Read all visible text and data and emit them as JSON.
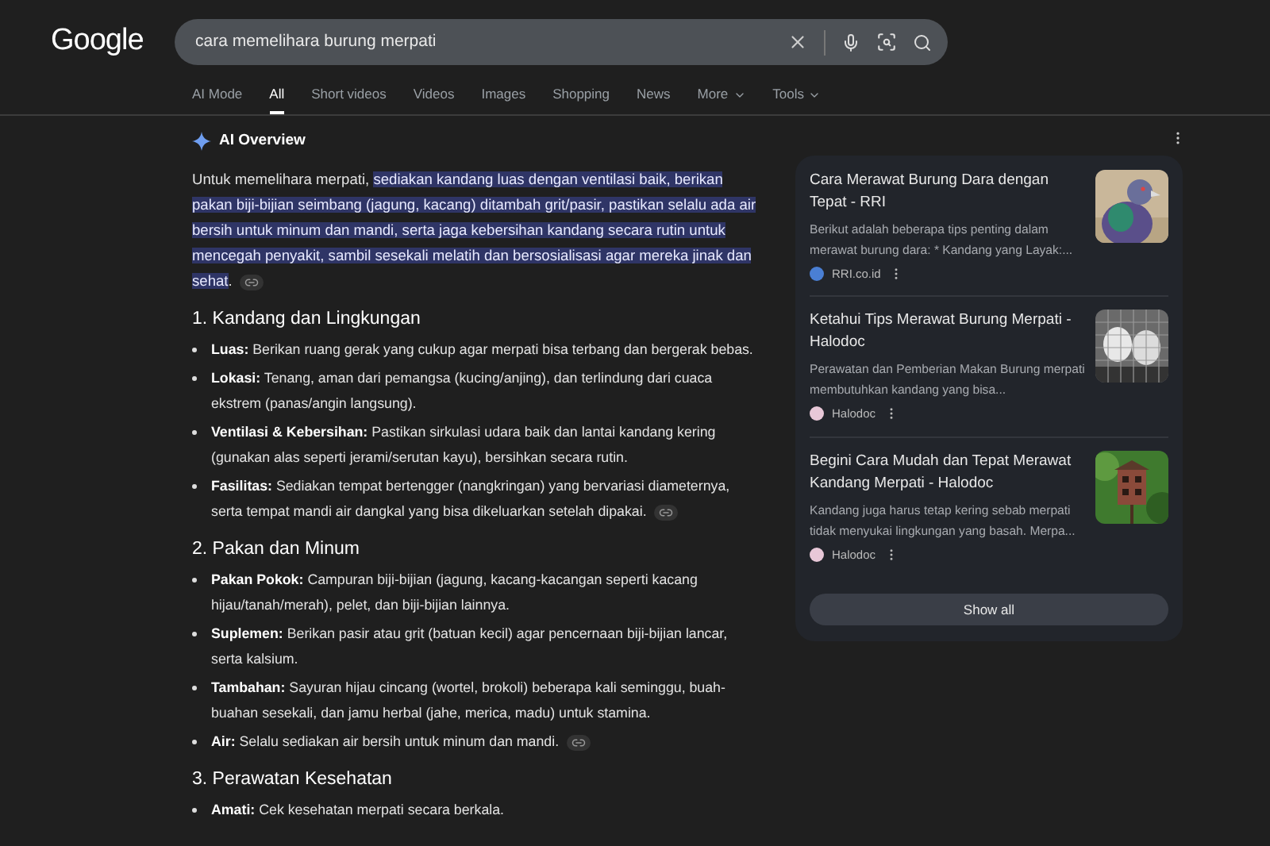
{
  "logo": "Google",
  "search": {
    "value": "cara memelihara burung merpati"
  },
  "tabs": [
    {
      "label": "AI Mode",
      "selected": false,
      "dropdown": false
    },
    {
      "label": "All",
      "selected": true,
      "dropdown": false
    },
    {
      "label": "Short videos",
      "selected": false,
      "dropdown": false
    },
    {
      "label": "Videos",
      "selected": false,
      "dropdown": false
    },
    {
      "label": "Images",
      "selected": false,
      "dropdown": false
    },
    {
      "label": "Shopping",
      "selected": false,
      "dropdown": false
    },
    {
      "label": "News",
      "selected": false,
      "dropdown": false
    },
    {
      "label": "More",
      "selected": false,
      "dropdown": true
    },
    {
      "label": "Tools",
      "selected": false,
      "dropdown": true
    }
  ],
  "ai_overview": {
    "title": "AI Overview",
    "intro": {
      "plain": "Untuk memelihara merpati,",
      "highlight": "sediakan kandang luas dengan ventilasi baik, berikan pakan biji-bijian seimbang (jagung, kacang) ditambah grit/pasir, pastikan selalu ada air bersih untuk minum dan mandi, serta jaga kebersihan kandang secara rutin untuk mencegah penyakit, sambil sesekali melatih dan bersosialisasi agar mereka jinak dan sehat",
      "end": "."
    },
    "sections": [
      {
        "heading": "1. Kandang dan Lingkungan",
        "items": [
          {
            "label": "Luas:",
            "text": "Berikan ruang gerak yang cukup agar merpati bisa terbang dan bergerak bebas.",
            "link": false
          },
          {
            "label": "Lokasi:",
            "text": "Tenang, aman dari pemangsa (kucing/anjing), dan terlindung dari cuaca ekstrem (panas/angin langsung).",
            "link": false
          },
          {
            "label": "Ventilasi & Kebersihan:",
            "text": "Pastikan sirkulasi udara baik dan lantai kandang kering (gunakan alas seperti jerami/serutan kayu), bersihkan secara rutin.",
            "link": false
          },
          {
            "label": "Fasilitas:",
            "text": "Sediakan tempat bertengger (nangkringan) yang bervariasi diameternya, serta tempat mandi air dangkal yang bisa dikeluarkan setelah dipakai.",
            "link": true
          }
        ]
      },
      {
        "heading": "2. Pakan dan Minum",
        "items": [
          {
            "label": "Pakan Pokok:",
            "text": "Campuran biji-bijian (jagung, kacang-kacangan seperti kacang hijau/tanah/merah), pelet, dan biji-bijian lainnya.",
            "link": false
          },
          {
            "label": "Suplemen:",
            "text": "Berikan pasir atau grit (batuan kecil) agar pencernaan biji-bijian lancar, serta kalsium.",
            "link": false
          },
          {
            "label": "Tambahan:",
            "text": "Sayuran hijau cincang (wortel, brokoli) beberapa kali seminggu, buah-buahan sesekali, dan jamu herbal (jahe, merica, madu) untuk stamina.",
            "link": false
          },
          {
            "label": "Air:",
            "text": "Selalu sediakan air bersih untuk minum dan mandi.",
            "link": true
          }
        ]
      },
      {
        "heading": "3. Perawatan Kesehatan",
        "items": [
          {
            "label": "Amati:",
            "text": "Cek kesehatan merpati secara berkala.",
            "link": false
          }
        ]
      }
    ]
  },
  "sources": {
    "cards": [
      {
        "title": "Cara Merawat Burung Dara dengan Tepat - RRI",
        "snippet": "Berikut adalah beberapa tips penting dalam merawat burung dara: * Kandang yang Layak:...",
        "source": "RRI.co.id",
        "color": "#4a7fd4"
      },
      {
        "title": "Ketahui Tips Merawat Burung Merpati - Halodoc",
        "snippet": "Perawatan dan Pemberian Makan Burung merpati membutuhkan kandang yang bisa...",
        "source": "Halodoc",
        "color": "#e8c8d8"
      },
      {
        "title": "Begini Cara Mudah dan Tepat Merawat Kandang Merpati - Halodoc",
        "snippet": "Kandang juga harus tetap kering sebab merpati tidak menyukai lingkungan yang basah. Merpa...",
        "source": "Halodoc",
        "color": "#e8c8d8"
      }
    ],
    "button": "Show all"
  }
}
